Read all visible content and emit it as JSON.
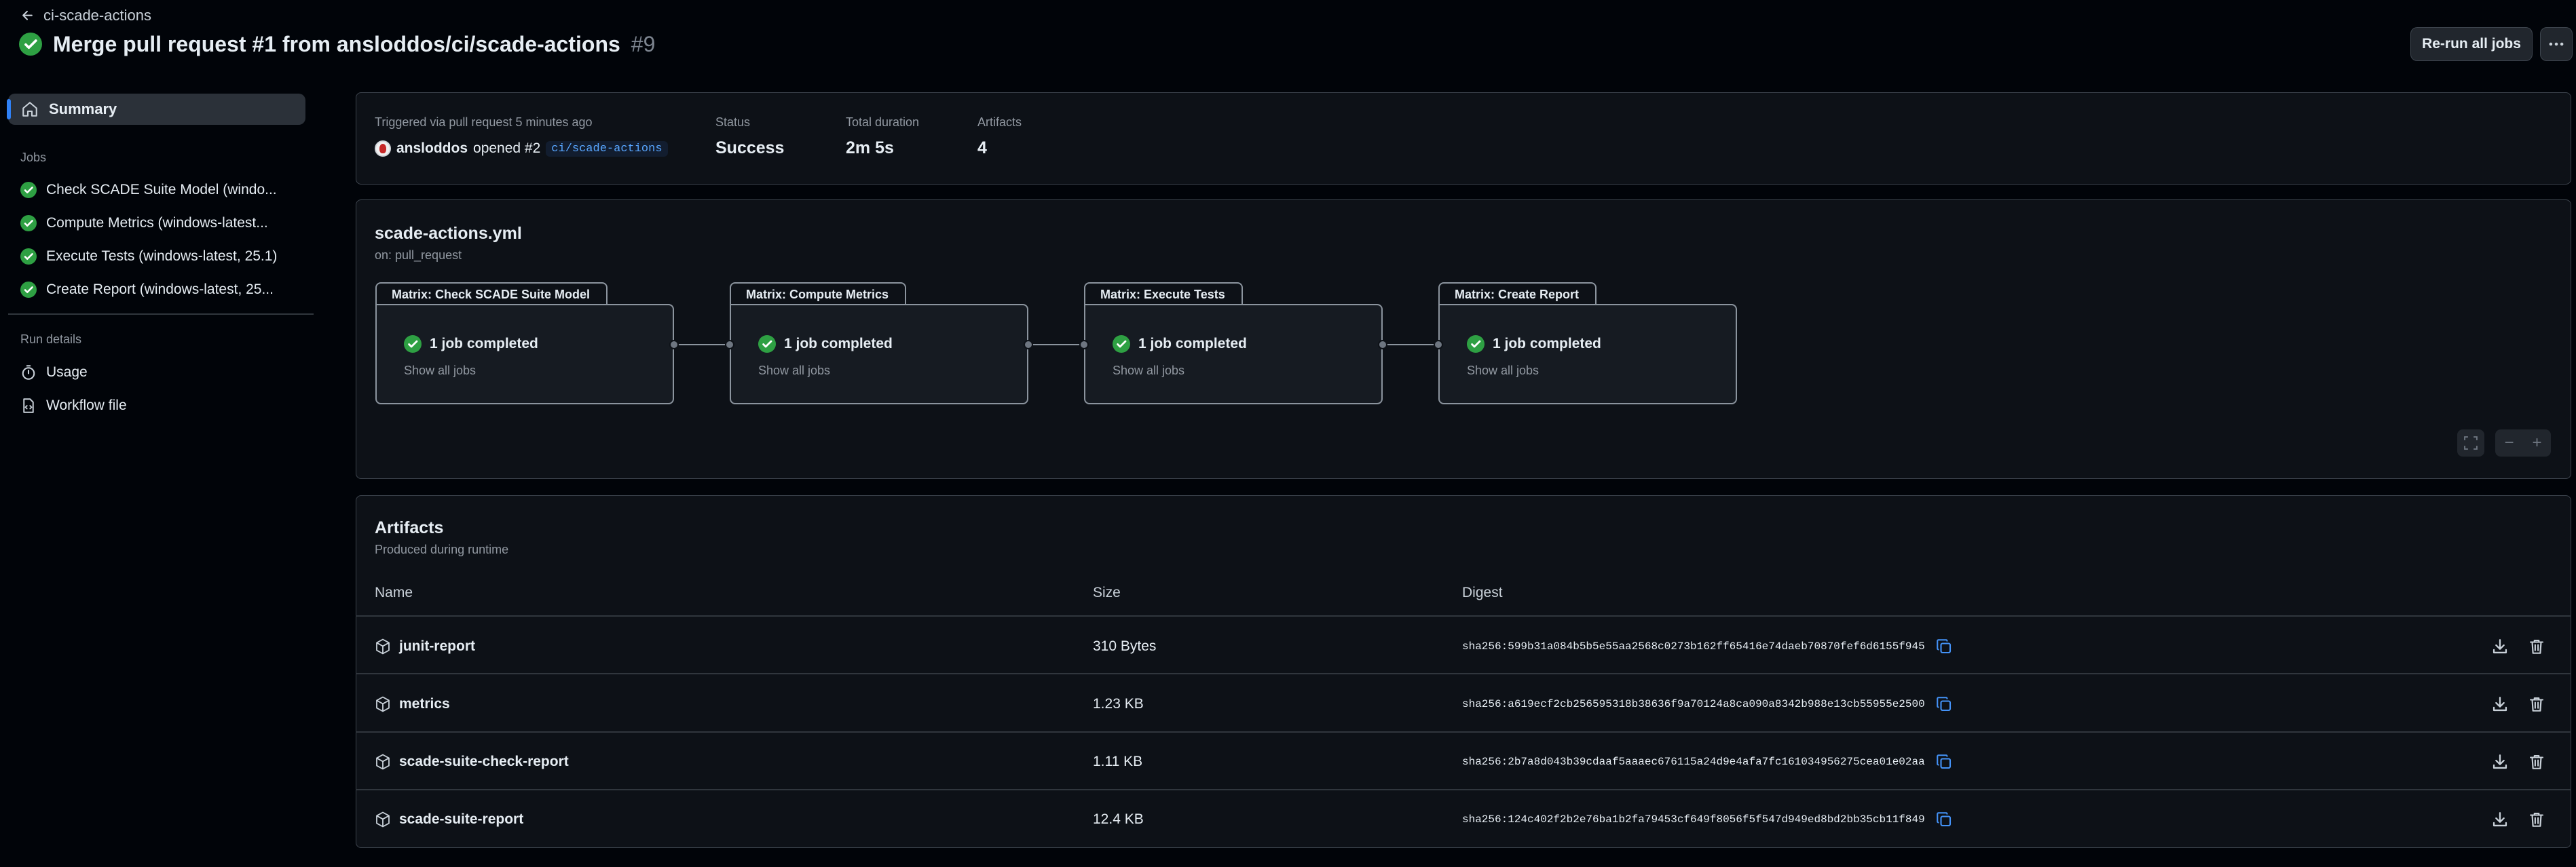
{
  "header": {
    "back_label": "ci-scade-actions",
    "title": "Merge pull request #1 from ansloddos/ci/scade-actions",
    "run_number": "#9",
    "rerun_label": "Re-run all jobs"
  },
  "sidebar": {
    "summary_label": "Summary",
    "jobs_heading": "Jobs",
    "jobs": [
      {
        "label": "Check SCADE Suite Model (windo..."
      },
      {
        "label": "Compute Metrics (windows-latest..."
      },
      {
        "label": "Execute Tests (windows-latest, 25.1)"
      },
      {
        "label": "Create Report (windows-latest, 25..."
      }
    ],
    "run_details_heading": "Run details",
    "usage_label": "Usage",
    "workflow_file_label": "Workflow file"
  },
  "summary": {
    "trigger_text": "Triggered via pull request 5 minutes ago",
    "user": "ansloddos",
    "action": "opened #2",
    "branch": "ci/scade-actions",
    "status_label": "Status",
    "status_value": "Success",
    "duration_label": "Total duration",
    "duration_value": "2m 5s",
    "artifacts_label": "Artifacts",
    "artifacts_value": "4"
  },
  "workflow": {
    "file": "scade-actions.yml",
    "trigger": "on: pull_request",
    "jobs": [
      {
        "tab": "Matrix: Check SCADE Suite Model",
        "status": "1 job completed",
        "link": "Show all jobs"
      },
      {
        "tab": "Matrix: Compute Metrics",
        "status": "1 job completed",
        "link": "Show all jobs"
      },
      {
        "tab": "Matrix: Execute Tests",
        "status": "1 job completed",
        "link": "Show all jobs"
      },
      {
        "tab": "Matrix: Create Report",
        "status": "1 job completed",
        "link": "Show all jobs"
      }
    ]
  },
  "artifacts": {
    "title": "Artifacts",
    "subtitle": "Produced during runtime",
    "columns": {
      "name": "Name",
      "size": "Size",
      "digest": "Digest"
    },
    "rows": [
      {
        "name": "junit-report",
        "size": "310 Bytes",
        "digest": "sha256:599b31a084b5b5e55aa2568c0273b162ff65416e74daeb70870fef6d6155f945"
      },
      {
        "name": "metrics",
        "size": "1.23 KB",
        "digest": "sha256:a619ecf2cb256595318b38636f9a70124a8ca090a8342b988e13cb55955e2500"
      },
      {
        "name": "scade-suite-check-report",
        "size": "1.11 KB",
        "digest": "sha256:2b7a8d043b39cdaaf5aaaec676115a24d9e4afa7fc161034956275cea01e02aa"
      },
      {
        "name": "scade-suite-report",
        "size": "12.4 KB",
        "digest": "sha256:124c402f2b2e76ba1b2fa79453cf649f8056f5f547d949ed8bd2bb35cb11f849"
      }
    ]
  },
  "colors": {
    "success": "#2ea043",
    "accent": "#2f81f7",
    "background": "#010409"
  }
}
